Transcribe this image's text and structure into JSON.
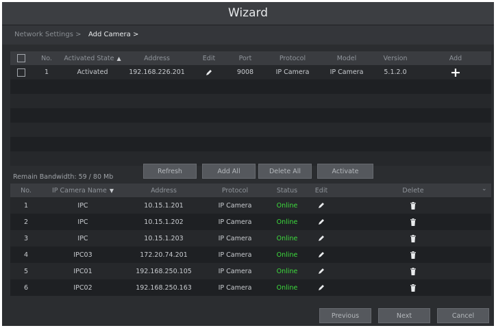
{
  "window": {
    "title": "Wizard"
  },
  "breadcrumb": {
    "items": [
      "Network Settings >",
      "Add Camera >"
    ]
  },
  "search_table": {
    "headers": {
      "no": "No.",
      "activated_state": "Activated State",
      "address": "Address",
      "edit": "Edit",
      "port": "Port",
      "protocol": "Protocol",
      "model": "Model",
      "version": "Version",
      "add": "Add"
    },
    "rows": [
      {
        "no": "1",
        "activated_state": "Activated",
        "address": "192.168.226.201",
        "port": "9008",
        "protocol": "IP Camera",
        "model": "IP Camera",
        "version": "5.1.2.0"
      }
    ]
  },
  "bandwidth": {
    "label": "Remain Bandwidth: 59 / 80 Mb"
  },
  "actions": {
    "refresh": "Refresh",
    "add_all": "Add All",
    "delete_all": "Delete All",
    "activate": "Activate"
  },
  "added_table": {
    "headers": {
      "no": "No.",
      "name": "IP Camera Name",
      "address": "Address",
      "protocol": "Protocol",
      "status": "Status",
      "edit": "Edit",
      "delete": "Delete"
    },
    "rows": [
      {
        "no": "1",
        "name": "IPC",
        "address": "10.15.1.201",
        "protocol": "IP Camera",
        "status": "Online"
      },
      {
        "no": "2",
        "name": "IPC",
        "address": "10.15.1.202",
        "protocol": "IP Camera",
        "status": "Online"
      },
      {
        "no": "3",
        "name": "IPC",
        "address": "10.15.1.203",
        "protocol": "IP Camera",
        "status": "Online"
      },
      {
        "no": "4",
        "name": "IPC03",
        "address": "172.20.74.201",
        "protocol": "IP Camera",
        "status": "Online"
      },
      {
        "no": "5",
        "name": "IPC01",
        "address": "192.168.250.105",
        "protocol": "IP Camera",
        "status": "Online"
      },
      {
        "no": "6",
        "name": "IPC02",
        "address": "192.168.250.163",
        "protocol": "IP Camera",
        "status": "Online"
      }
    ]
  },
  "footer": {
    "previous": "Previous",
    "next": "Next",
    "cancel": "Cancel"
  },
  "icons": {
    "select_all": "checkbox-icon",
    "row_select": "checkbox-icon",
    "sort": "sort-icon",
    "edit": "pencil-icon",
    "add": "plus-icon",
    "delete": "trash-icon",
    "collapse": "chevron-down-icon"
  },
  "colors": {
    "window_bg": "#2b2d30",
    "header_bg": "#3a3c40",
    "online": "#3ddc3d",
    "button_bg": "#55585d"
  }
}
